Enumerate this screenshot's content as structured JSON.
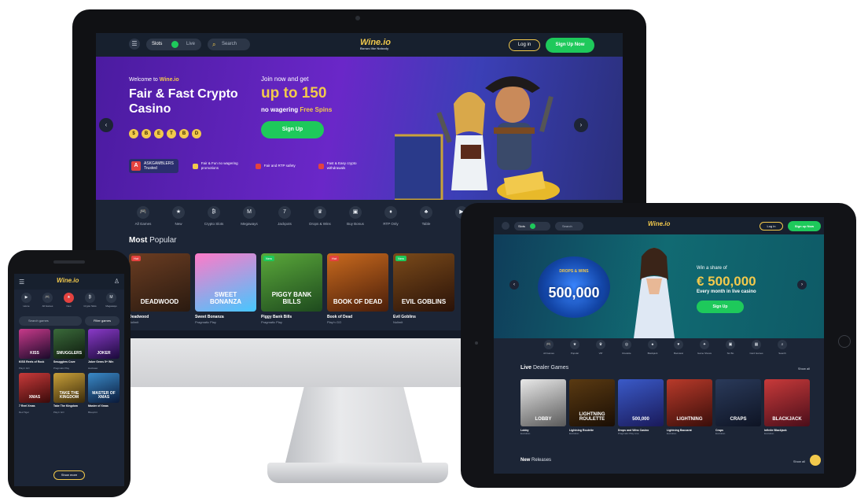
{
  "desktop": {
    "nav": {
      "toggle_left": "Slots",
      "toggle_right": "Live",
      "search": "Search",
      "logo": "Wine.io",
      "tagline": "Bonus like Nobody",
      "login": "Log in",
      "signup": "Sign Up Now"
    },
    "hero": {
      "welcome_prefix": "Welcome to",
      "welcome_brand": "Wine.io",
      "title": "Fair & Fast Crypto Casino",
      "coins": [
        "$",
        "B",
        "E",
        "T",
        "B",
        "D"
      ],
      "join": "Join now and get",
      "upto": "up to 150",
      "nowager_prefix": "no wagering",
      "nowager_highlight": "Free Spins",
      "signup": "Sign Up",
      "ask_label": "ASKGAMBLERS",
      "ask_sub": "Trusted",
      "features": [
        "Fair & Fun no wagering promotions",
        "Fair and RTP safety",
        "Fast & Easy crypto withdrawals"
      ]
    },
    "categories": [
      {
        "icon": "🎮",
        "label": "All Games"
      },
      {
        "icon": "★",
        "label": "New"
      },
      {
        "icon": "₿",
        "label": "Crypto Slots"
      },
      {
        "icon": "M",
        "label": "Megaways"
      },
      {
        "icon": "7",
        "label": "Jackpots"
      },
      {
        "icon": "♛",
        "label": "Drops & Wins"
      },
      {
        "icon": "▣",
        "label": "Buy Bonus"
      },
      {
        "icon": "♦",
        "label": "RTP Only"
      },
      {
        "icon": "♣",
        "label": "Table"
      },
      {
        "icon": "▶",
        "label": ""
      },
      {
        "icon": "🔍",
        "label": ""
      }
    ],
    "most_bold": "Most",
    "most_rest": "Popular",
    "games": [
      {
        "badge": "Hot",
        "title": "DEADWOOD",
        "name": "Deadwood",
        "provider": "Nolimit",
        "c1": "#6b3d22",
        "c2": "#2a1a10"
      },
      {
        "badge": "",
        "title": "SWEET BONANZA",
        "name": "Sweet Bonanza",
        "provider": "Pragmatic Play",
        "c1": "#ff7ac8",
        "c2": "#45c7ff"
      },
      {
        "badge": "New",
        "title": "PIGGY BANK BILLS",
        "name": "Piggy Bank Bills",
        "provider": "Pragmatic Play",
        "c1": "#5aa83a",
        "c2": "#1e4a1e"
      },
      {
        "badge": "Hot",
        "title": "BOOK OF DEAD",
        "name": "Book of Dead",
        "provider": "Play'n GO",
        "c1": "#c96a1e",
        "c2": "#4a1e0a"
      },
      {
        "badge": "New",
        "title": "EVIL GOBLINS",
        "name": "Evil Goblins",
        "provider": "Nolimit",
        "c1": "#7a4a1a",
        "c2": "#2a1208"
      }
    ]
  },
  "tablet": {
    "nav": {
      "toggle": "Slots",
      "search": "Search",
      "logo": "Wine.io",
      "login": "Log in",
      "signup": "Sign up Now"
    },
    "hero": {
      "logo_small": "DROPS & WINS",
      "logo_big": "500,000",
      "share": "Win a share of",
      "amount": "€ 500,000",
      "every": "Every month in live casino",
      "button": "Sign Up"
    },
    "categories": [
      "All Games",
      "Popular",
      "VIP",
      "Roulette",
      "Blackjack",
      "Baccarat",
      "Game Shows",
      "Sic Bo",
      "Card Games",
      "Search"
    ],
    "live_bold": "Live",
    "live_rest": "Dealer Games",
    "show_all": "Show all",
    "games": [
      {
        "title": "LOBBY",
        "name": "Lobby",
        "provider": "Evolution",
        "c1": "#e8e8e8",
        "c2": "#5a5a5a"
      },
      {
        "title": "LIGHTNING ROULETTE",
        "name": "Lightning Roulette",
        "provider": "Evolution",
        "c1": "#5a3a12",
        "c2": "#1a0e04"
      },
      {
        "title": "500,000",
        "name": "Drops and Wins Casino",
        "provider": "Pragmatic Play Live",
        "c1": "#3a5ac8",
        "c2": "#1a1a5a"
      },
      {
        "title": "LIGHTNING",
        "name": "Lightning Baccarat",
        "provider": "Evolution",
        "c1": "#b83a2a",
        "c2": "#3a0e0a"
      },
      {
        "title": "CRAPS",
        "name": "Craps",
        "provider": "Evolution",
        "c1": "#2a3a5a",
        "c2": "#0e1424"
      },
      {
        "title": "BLACKJACK",
        "name": "Infinite Blackjack",
        "provider": "Evolution",
        "c1": "#c83a3a",
        "c2": "#4a0e1a"
      }
    ],
    "new_bold": "New",
    "new_rest": "Releases",
    "show_all_2": "Show all"
  },
  "phone": {
    "logo": "Wine.io",
    "categories": [
      {
        "icon": "▶",
        "label": "Home",
        "active": false
      },
      {
        "icon": "🎮",
        "label": "All Games",
        "active": false
      },
      {
        "icon": "★",
        "label": "New",
        "active": true
      },
      {
        "icon": "₿",
        "label": "Crypto Slots",
        "active": false
      },
      {
        "icon": "M",
        "label": "Megaways",
        "active": false
      }
    ],
    "search": "Search games",
    "filter": "Filter games",
    "games": [
      {
        "title": "KISS",
        "name": "KISS Reels of Rock",
        "provider": "Play'n GO",
        "c1": "#c83a8a",
        "c2": "#1a0a2a"
      },
      {
        "title": "SMUGGLERS",
        "name": "Smugglers Cove",
        "provider": "Pragmatic Play",
        "c1": "#3a6a3a",
        "c2": "#0e1a0e"
      },
      {
        "title": "JOKER",
        "name": "Joker Gems 5+ Win",
        "provider": "Hacksaw",
        "c1": "#8a3ac8",
        "c2": "#1a0a3a"
      },
      {
        "title": "XMAS",
        "name": "7 Reel Xmas",
        "provider": "Red Tiger",
        "c1": "#c83a3a",
        "c2": "#3a0a0a"
      },
      {
        "title": "TAKE THE KINGDOM",
        "name": "Take The Kingdom",
        "provider": "Play'n GO",
        "c1": "#c8a03a",
        "c2": "#3a2a0a"
      },
      {
        "title": "MASTER OF XMAS",
        "name": "Master of Xmas",
        "provider": "Blueprint",
        "c1": "#3a8ac8",
        "c2": "#0a1a3a"
      }
    ],
    "show_more": "Show more"
  }
}
